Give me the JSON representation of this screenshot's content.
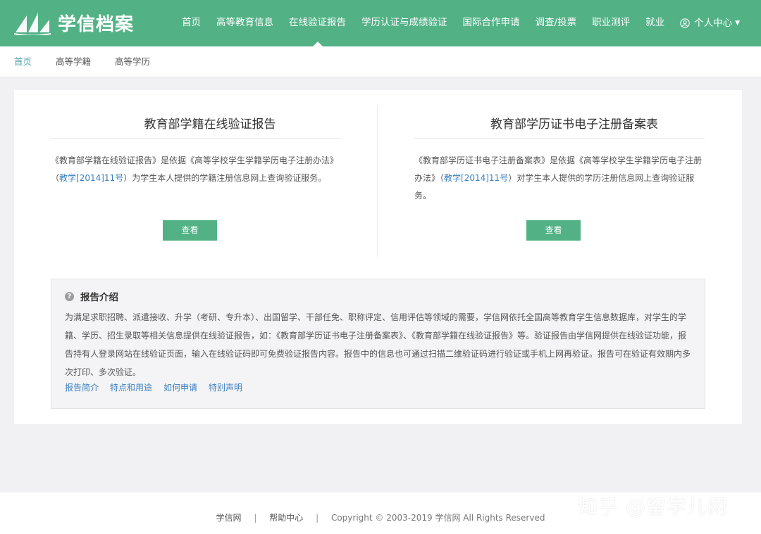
{
  "header": {
    "logo_text": "学信档案",
    "nav": [
      {
        "label": "首页"
      },
      {
        "label": "高等教育信息"
      },
      {
        "label": "在线验证报告"
      },
      {
        "label": "学历认证与成绩验证"
      },
      {
        "label": "国际合作申请"
      },
      {
        "label": "调查/投票"
      },
      {
        "label": "职业测评"
      },
      {
        "label": "就业"
      }
    ],
    "user_menu": "个人中心"
  },
  "breadcrumb": {
    "items": [
      "首页",
      "高等学籍",
      "高等学历"
    ]
  },
  "cards": [
    {
      "title": "教育部学籍在线验证报告",
      "desc_a": "《教育部学籍在线验证报告》是依据《高等学校学生学籍学历电子注册办法》（",
      "desc_link": "教学[2014]11号",
      "desc_b": "）为学生本人提供的学籍注册信息网上查询验证服务。",
      "button": "查看"
    },
    {
      "title": "教育部学历证书电子注册备案表",
      "desc_a": "《教育部学历证书电子注册备案表》是依据《高等学校学生学籍学历电子注册办法》（",
      "desc_link": "教学[2014]11号",
      "desc_b": "）对学生本人提供的学历注册信息网上查询验证服务。",
      "button": "查看"
    }
  ],
  "intro": {
    "title": "报告介绍",
    "body": "为满足求职招聘、派遣接收、升学（考研、专升本）、出国留学、干部任免、职称评定、信用评估等领域的需要，学信网依托全国高等教育学生信息数据库，对学生的学籍、学历、招生录取等相关信息提供在线验证报告，如：《教育部学历证书电子注册备案表》、《教育部学籍在线验证报告》等。验证报告由学信网提供在线验证功能，报告持有人登录网站在线验证页面，输入在线验证码即可免费验证报告内容。报告中的信息也可通过扫描二维验证码进行验证或手机上网再验证。报告可在验证有效期内多次打印、多次验证。",
    "links": [
      "报告简介",
      "特点和用途",
      "如何申请",
      "特别声明"
    ]
  },
  "footer": {
    "link1": "学信网",
    "link2": "帮助中心",
    "copyright": "Copyright © 2003-2019 学信网 All Rights Reserved",
    "separator": "|"
  },
  "watermark": "知乎 @留学儿网",
  "colors": {
    "brand_green": "#52b286",
    "link_blue": "#3a7fc0"
  }
}
